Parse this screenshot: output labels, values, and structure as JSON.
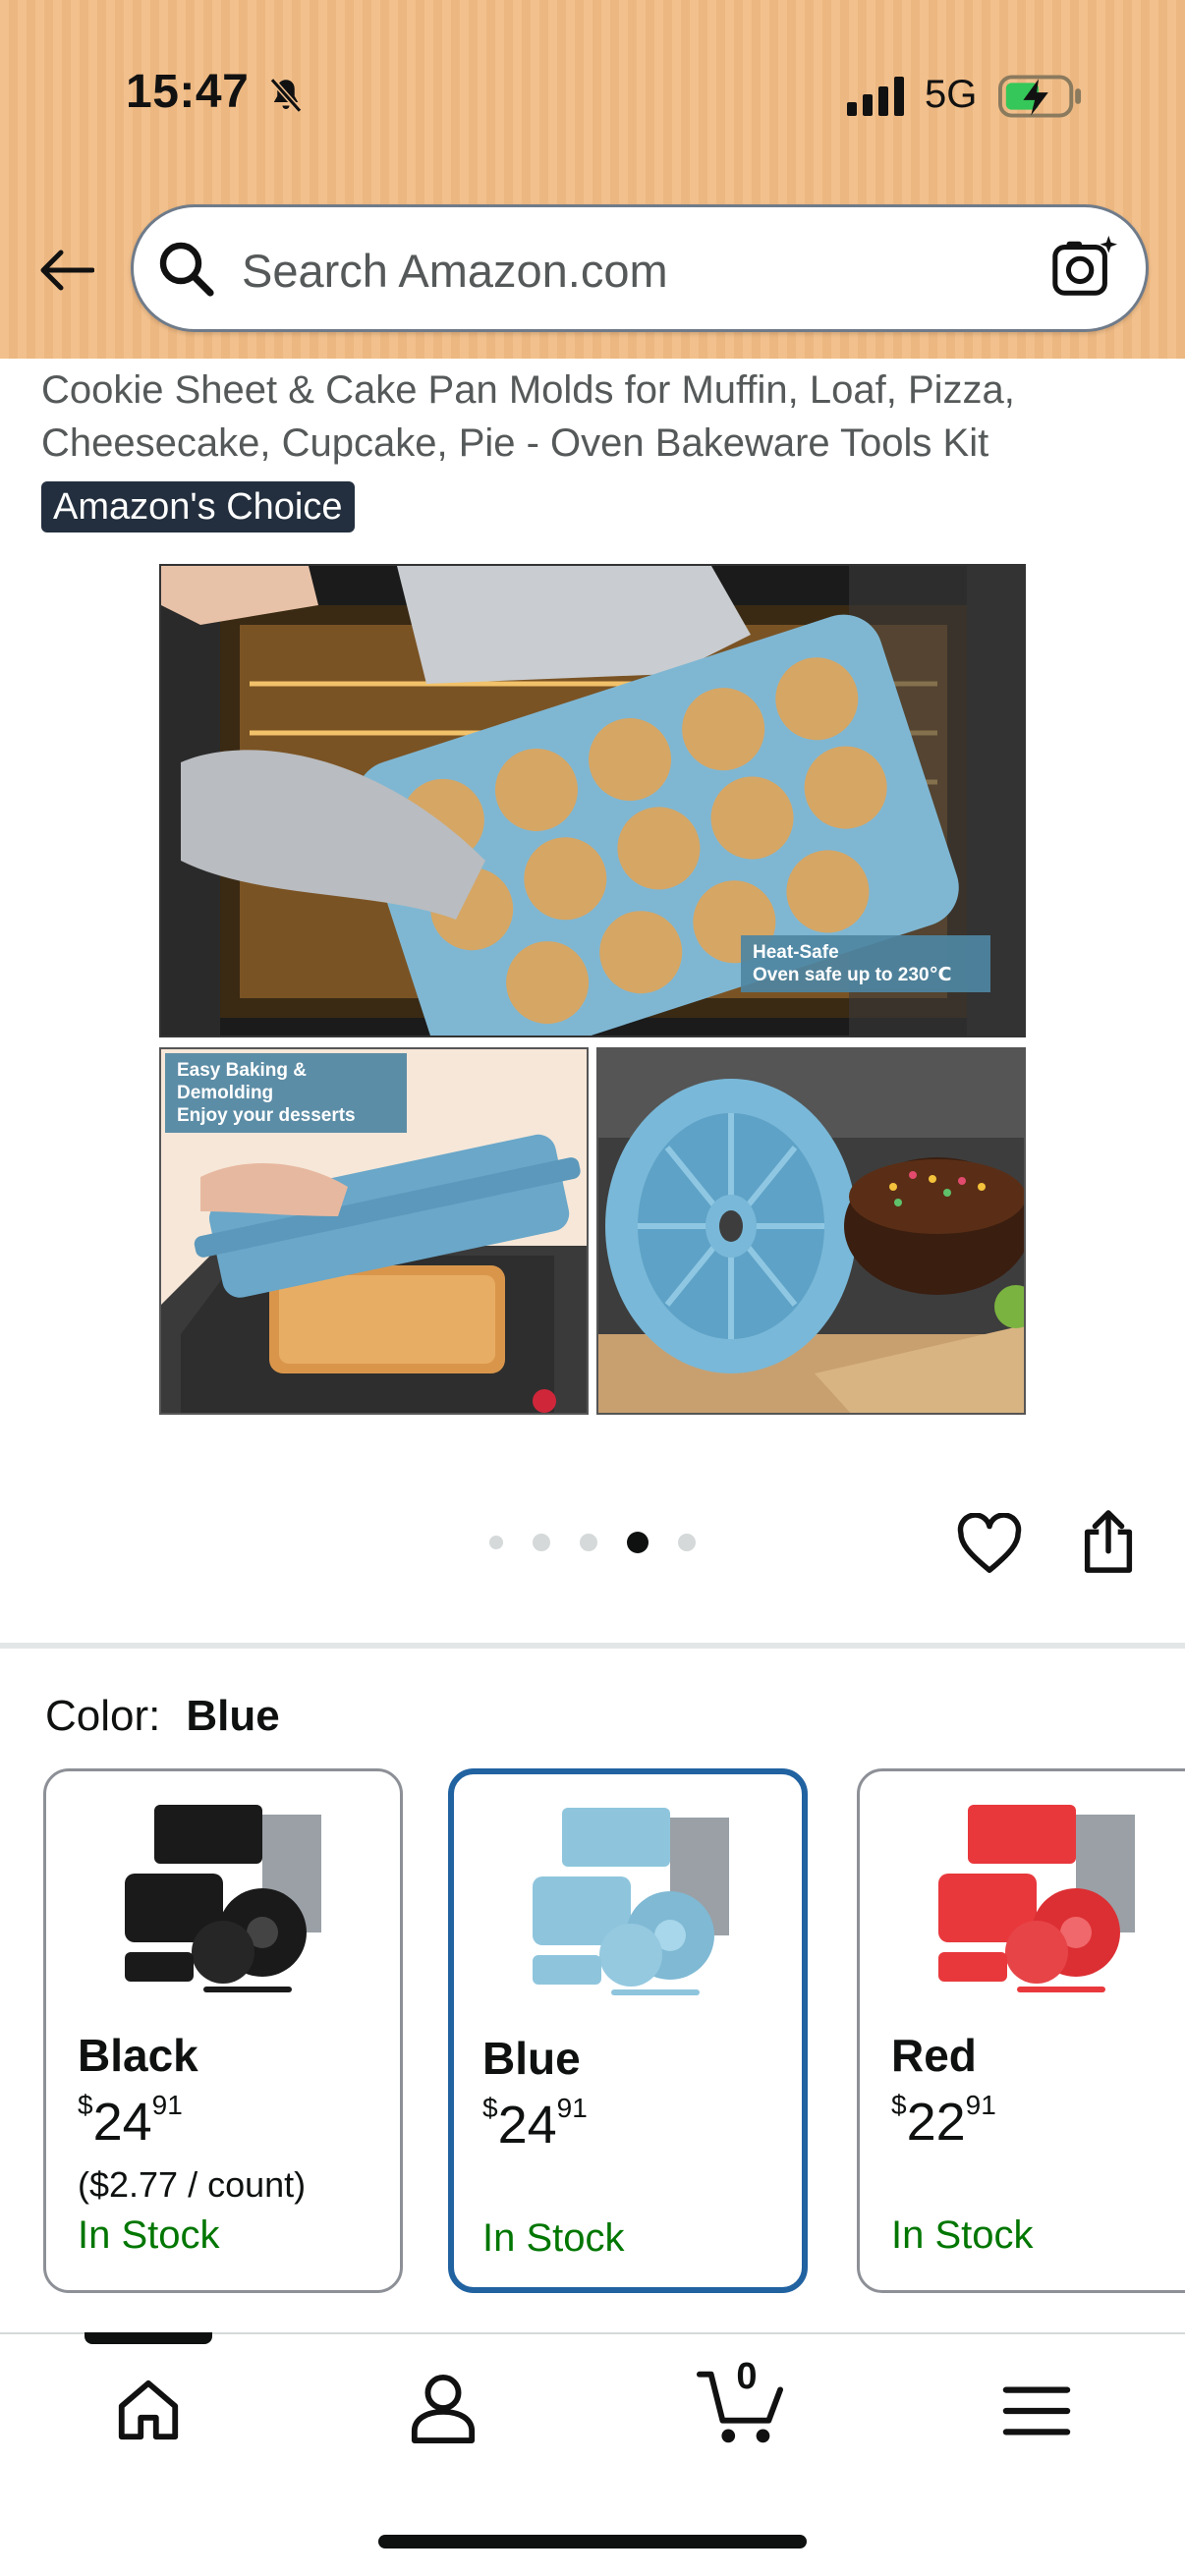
{
  "status_bar": {
    "time": "15:47",
    "network": "5G"
  },
  "search": {
    "placeholder": "Search Amazon.com"
  },
  "product": {
    "title_line1": "Cookie Sheet & Cake Pan Molds for Muffin, Loaf, Pizza,",
    "title_line2": "Cheesecake, Cupcake, Pie - Oven Bakeware Tools Kit",
    "badge": "Amazon's Choice"
  },
  "gallery": {
    "caption_heat_title": "Heat-Safe",
    "caption_heat_text": "Oven safe up to 230℃",
    "caption_easy_title": "Easy Baking & Demolding",
    "caption_easy_text": "Enjoy your desserts",
    "dots_total": 5,
    "active_dot": 4
  },
  "color": {
    "label": "Color:",
    "selected": "Blue",
    "options": [
      {
        "name": "Black",
        "currency": "$",
        "price_whole": "24",
        "price_fraction": "91",
        "unit_price": "($2.77 / count)",
        "stock": "In Stock",
        "swatch_color": "#1a1a1a"
      },
      {
        "name": "Blue",
        "currency": "$",
        "price_whole": "24",
        "price_fraction": "91",
        "unit_price": "",
        "stock": "In Stock",
        "swatch_color": "#8ec5dd"
      },
      {
        "name": "Red",
        "currency": "$",
        "price_whole": "22",
        "price_fraction": "91",
        "unit_price": "",
        "stock": "In Stock",
        "swatch_color": "#e8383c"
      }
    ]
  },
  "bottom_nav": {
    "cart_count": "0"
  },
  "colors": {
    "header_bg": "#f2c08c",
    "badge_bg": "#232f3e",
    "in_stock": "#007600",
    "selected_border": "#2162a1"
  }
}
